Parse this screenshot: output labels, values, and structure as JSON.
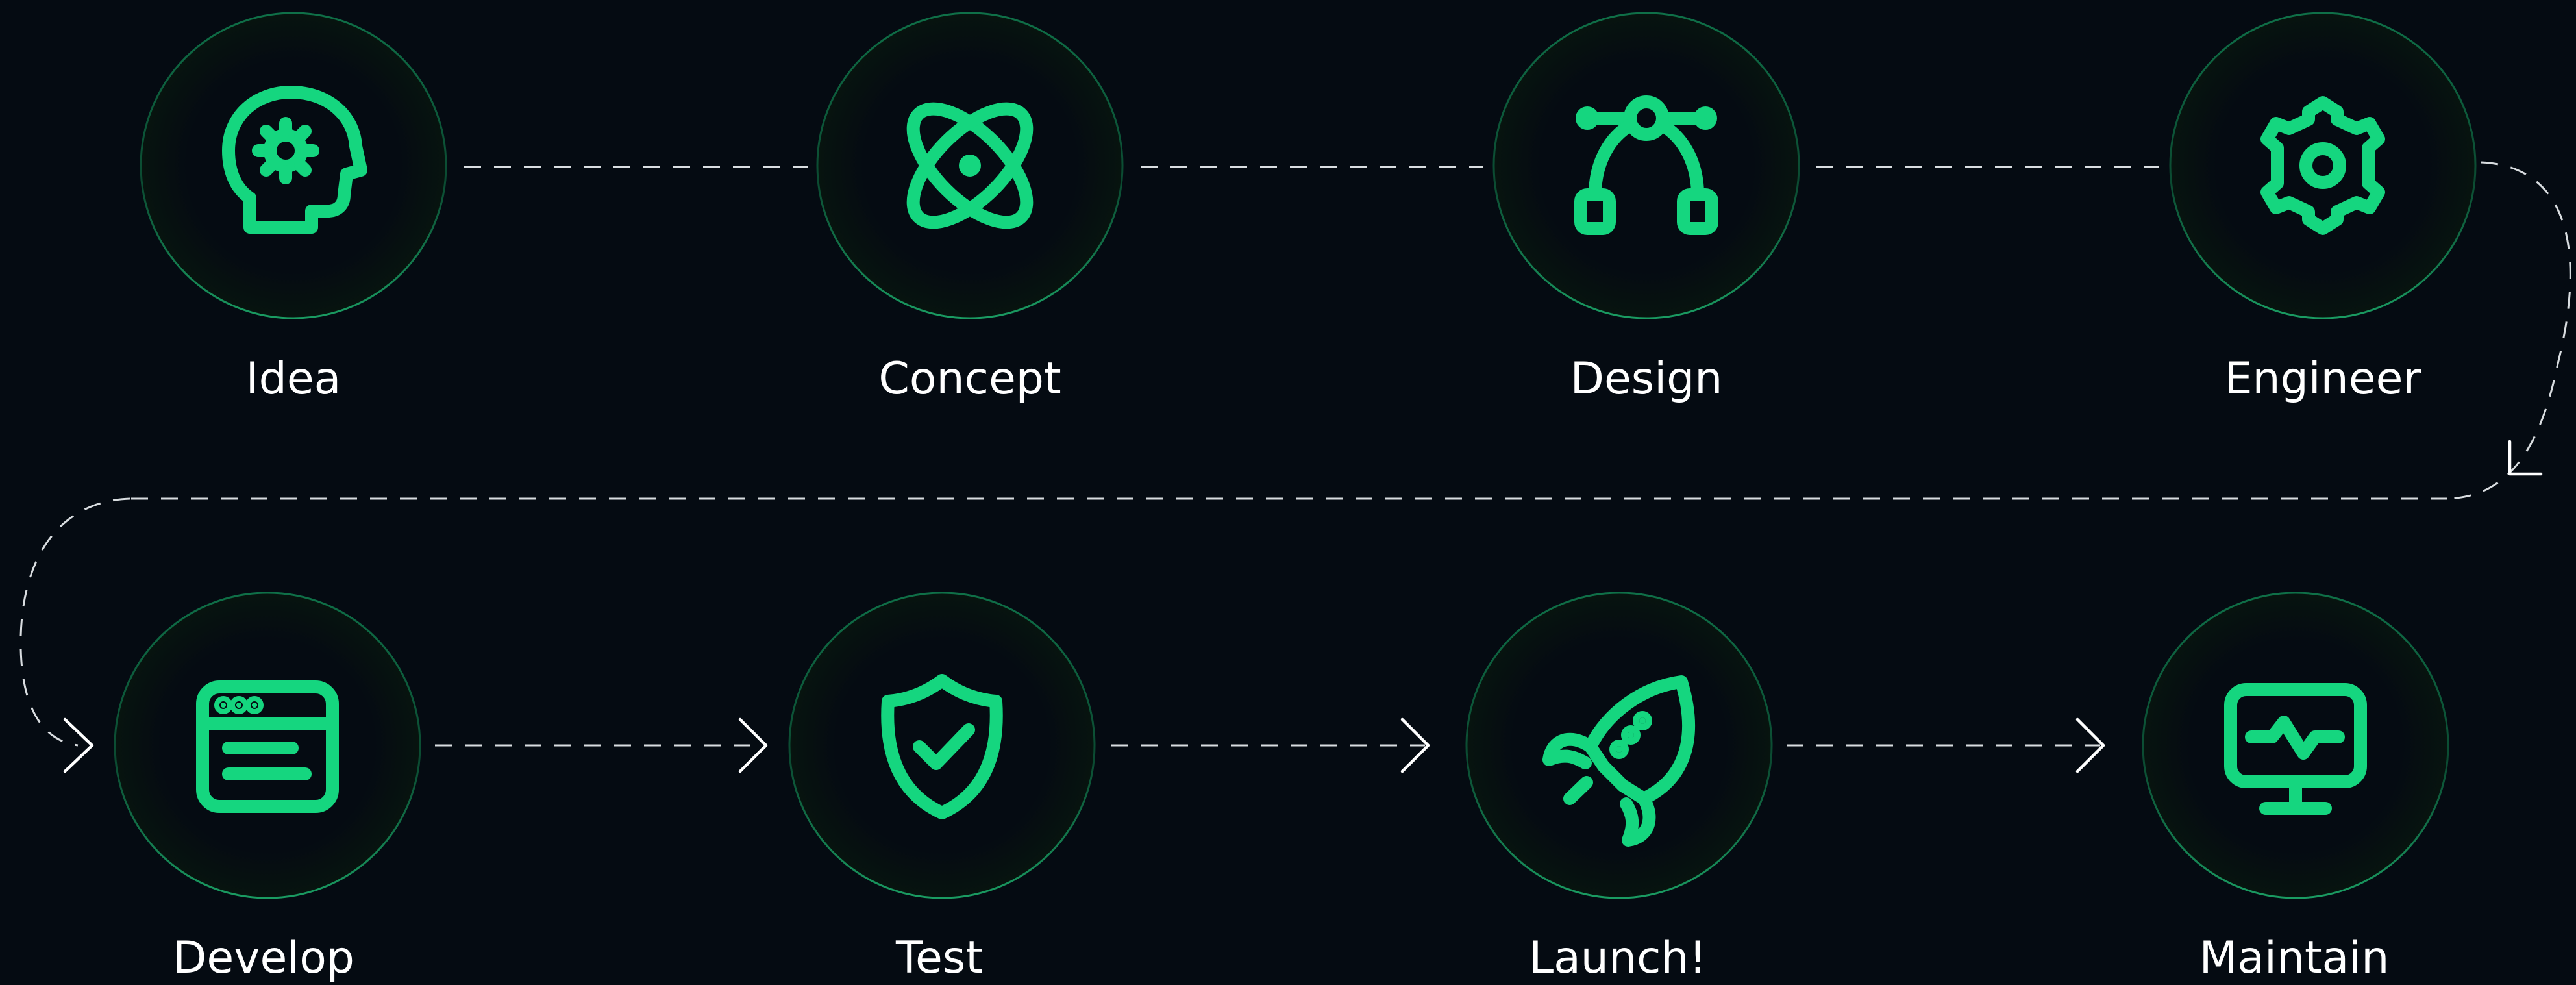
{
  "theme": {
    "background": "#050b12",
    "accent": "#15d67f",
    "ring": "#0c5a38",
    "connector": "#d9dde0",
    "label_color": "#ffffff"
  },
  "steps": [
    {
      "label": "Idea",
      "icon": "head-gear-icon"
    },
    {
      "label": "Concept",
      "icon": "atom-icon"
    },
    {
      "label": "Design",
      "icon": "bezier-curve-icon"
    },
    {
      "label": "Engineer",
      "icon": "gear-icon"
    },
    {
      "label": "Develop",
      "icon": "browser-window-icon"
    },
    {
      "label": "Test",
      "icon": "shield-check-icon"
    },
    {
      "label": "Launch!",
      "icon": "rocket-icon"
    },
    {
      "label": "Maintain",
      "icon": "monitor-pulse-icon"
    }
  ]
}
